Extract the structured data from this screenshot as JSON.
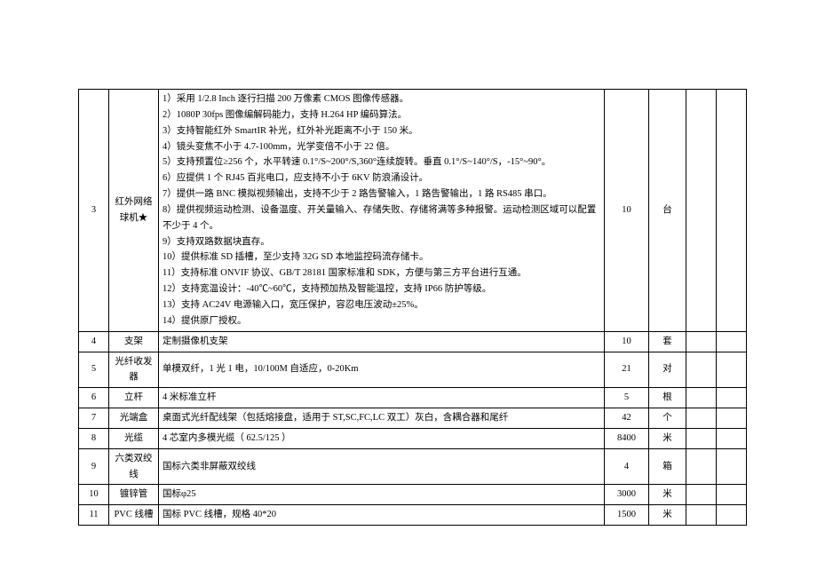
{
  "rows": [
    {
      "idx": "3",
      "name": "红外网络球机★",
      "spec_lines": [
        "1）采用 1/2.8 Inch 逐行扫描 200 万像素 CMOS 图像传感器。",
        "2）1080P 30fps 图像编解码能力，支持 H.264 HP 编码算法。",
        "3）支持智能红外 SmartIR 补光，红外补光距离不小于 150 米。",
        "4）镜头变焦不小于 4.7-100mm，光学变倍不小于 22 倍。",
        "5）支持预置位≥256 个，水平转速 0.1°/S~200°/S,360°连续旋转。垂直 0.1°/S~140°/S，-15°~90°。",
        "6）应提供 1 个 RJ45 百兆电口，应支持不小于 6KV 防浪涌设计。",
        "7）提供一路 BNC 模拟视频输出，支持不少于 2 路告警输入，1 路告警输出，1 路 RS485 串口。",
        "8）提供视频运动检测、设备温度、开关量输入、存储失败、存储将满等多种报警。运动检测区域可以配置不少于 4 个。",
        "9）支持双路数据块直存。",
        "10）提供标准 SD 插槽，至少支持 32G SD 本地监控码流存储卡。",
        "11）支持标准 ONVIF 协议、GB/T 28181 国家标准和 SDK，方便与第三方平台进行互通。",
        "12）支持宽温设计：-40℃~60℃，支持预加热及智能温控，支持 IP66 防护等级。",
        "13）支持 AC24V 电源输入口，宽压保护，容忍电压波动±25%。",
        "14）提供原厂授权。"
      ],
      "qty": "10",
      "unit": "台"
    },
    {
      "idx": "4",
      "name": "支架",
      "spec": "定制摄像机支架",
      "qty": "10",
      "unit": "套"
    },
    {
      "idx": "5",
      "name": "光纤收发器",
      "spec": "单模双纤，1 光 1 电，10/100M 自适应，0-20Km",
      "qty": "21",
      "unit": "对"
    },
    {
      "idx": "6",
      "name": "立杆",
      "spec": "4 米标准立杆",
      "qty": "5",
      "unit": "根"
    },
    {
      "idx": "7",
      "name": "光端盒",
      "spec": "桌面式光纤配线架（包括熔接盘，适用于 ST,SC,FC,LC 双工）灰白，含耦合器和尾纤",
      "qty": "42",
      "unit": "个"
    },
    {
      "idx": "8",
      "name": "光缆",
      "spec": "4 芯室内多模光缆（ 62.5/125 ）",
      "qty": "8400",
      "unit": "米"
    },
    {
      "idx": "9",
      "name": "六类双绞线",
      "spec": "国标六类非屏蔽双绞线",
      "qty": "4",
      "unit": "箱"
    },
    {
      "idx": "10",
      "name": "镀锌管",
      "spec": "国标φ25",
      "qty": "3000",
      "unit": "米"
    },
    {
      "idx": "11",
      "name": "PVC 线槽",
      "spec": "国标 PVC 线槽，规格 40*20",
      "qty": "1500",
      "unit": "米"
    }
  ]
}
